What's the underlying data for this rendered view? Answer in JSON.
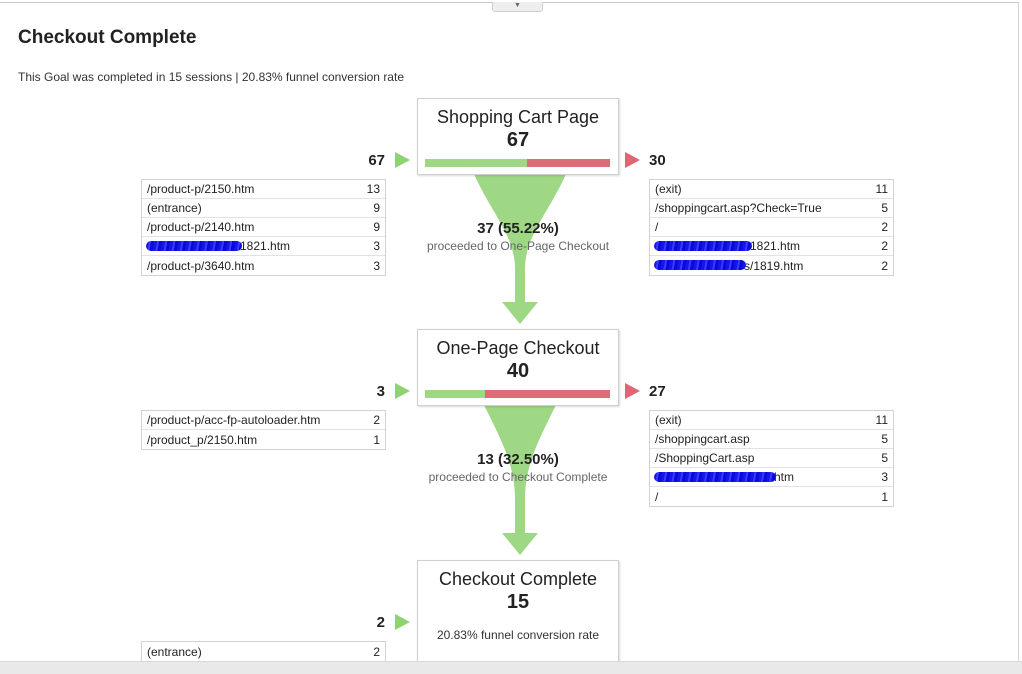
{
  "goal": {
    "title": "Checkout Complete",
    "summary": "This Goal was completed in 15 sessions | 20.83% funnel conversion rate"
  },
  "colors": {
    "entrance": "#8dd36f",
    "exit": "#e06673",
    "flow": "#9ed884"
  },
  "steps": [
    {
      "name": "Shopping Cart Page",
      "count": "67",
      "entered": "67",
      "exited": "30",
      "proceeded_fraction": 0.5522,
      "entrances": [
        {
          "page": "/product-p/2150.htm",
          "count": "13"
        },
        {
          "page": "(entrance)",
          "count": "9"
        },
        {
          "page": "/product-p/2140.htm",
          "count": "9"
        },
        {
          "page": "1821.htm",
          "count": "3",
          "redacted": true
        },
        {
          "page": "/product-p/3640.htm",
          "count": "3"
        }
      ],
      "exits": [
        {
          "page": "(exit)",
          "count": "11"
        },
        {
          "page": "/shoppingcart.asp?Check=True",
          "count": "5"
        },
        {
          "page": "/",
          "count": "2"
        },
        {
          "page": "1821.htm",
          "count": "2",
          "redacted": true
        },
        {
          "page": "s/1819.htm",
          "count": "2",
          "redacted": true
        }
      ],
      "proceed": {
        "count": "37 (55.22%)",
        "text": "proceeded to One-Page Checkout"
      }
    },
    {
      "name": "One-Page Checkout",
      "count": "40",
      "entered": "3",
      "exited": "27",
      "proceeded_fraction": 0.325,
      "entrances": [
        {
          "page": "/product-p/acc-fp-autoloader.htm",
          "count": "2"
        },
        {
          "page": "/product_p/2150.htm",
          "count": "1"
        }
      ],
      "exits": [
        {
          "page": "(exit)",
          "count": "11"
        },
        {
          "page": "/shoppingcart.asp",
          "count": "5"
        },
        {
          "page": "/ShoppingCart.asp",
          "count": "5"
        },
        {
          "page": "htm",
          "count": "3",
          "redacted": true
        },
        {
          "page": "/",
          "count": "1"
        }
      ],
      "proceed": {
        "count": "13 (32.50%)",
        "text": "proceeded to Checkout Complete"
      }
    },
    {
      "name": "Checkout Complete",
      "count": "15",
      "entered": "2",
      "rate": "20.83% funnel conversion rate",
      "entrances": [
        {
          "page": "(entrance)",
          "count": "2"
        }
      ]
    }
  ]
}
